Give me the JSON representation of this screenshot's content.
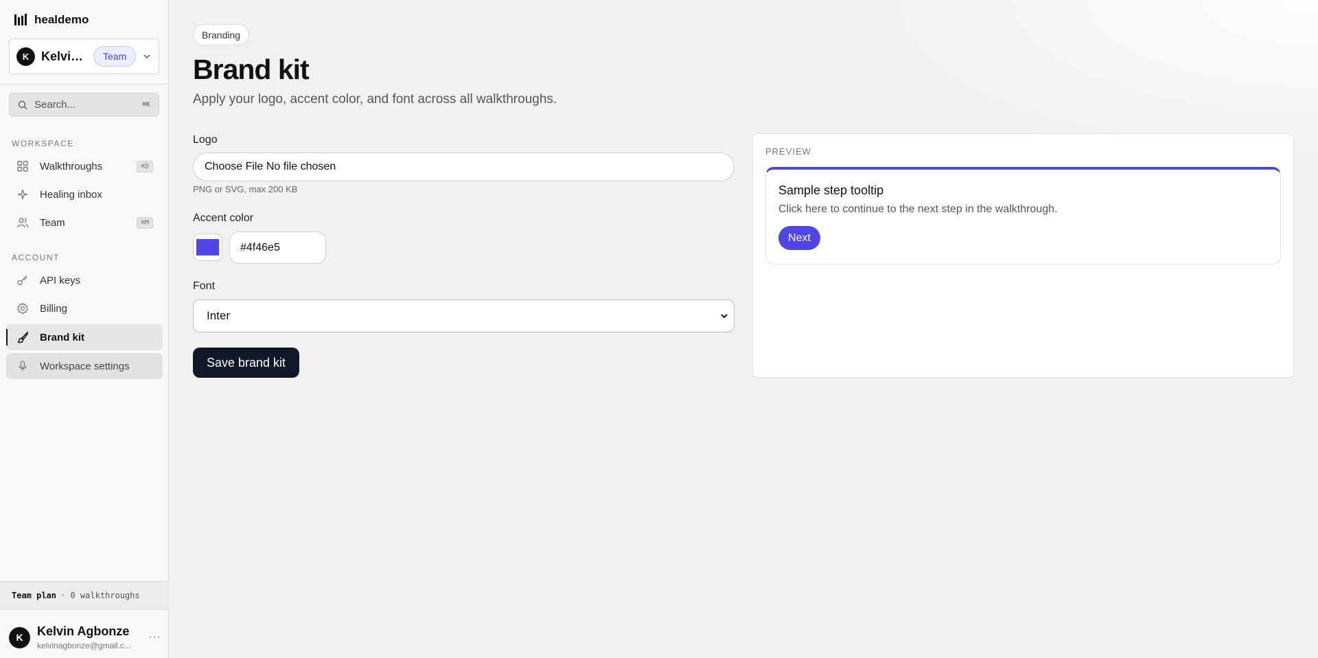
{
  "app": {
    "name": "healdemo"
  },
  "workspace_switcher": {
    "user_short": "Kelvin...",
    "badge": "Team"
  },
  "search": {
    "placeholder": "Search...",
    "shortcut": "⌘K"
  },
  "sidebar": {
    "workspace_label": "WORKSPACE",
    "account_label": "ACCOUNT",
    "workspace_items": [
      {
        "label": "Walkthroughs",
        "icon": "grid-icon",
        "shortcut": "⌘D"
      },
      {
        "label": "Healing inbox",
        "icon": "sparkle-icon",
        "shortcut": ""
      },
      {
        "label": "Team",
        "icon": "users-icon",
        "shortcut": "⌘M"
      }
    ],
    "account_items": [
      {
        "label": "API keys",
        "icon": "key-icon"
      },
      {
        "label": "Billing",
        "icon": "gear-icon"
      },
      {
        "label": "Brand kit",
        "icon": "paintbrush-icon",
        "active": true
      },
      {
        "label": "Workspace settings",
        "icon": "mic-icon"
      }
    ]
  },
  "plan": {
    "name": "Team plan",
    "detail": "· 0 walkthroughs"
  },
  "user": {
    "initial": "K",
    "name": "Kelvin Agbonze",
    "email": "kelvinagbonze@gmail.c...",
    "more": "···"
  },
  "page": {
    "breadcrumb": "Branding",
    "title": "Brand kit",
    "subtitle": "Apply your logo, accent color, and font across all walkthroughs."
  },
  "form": {
    "logo_label": "Logo",
    "logo_value": "Choose File No file chosen",
    "logo_hint": "PNG or SVG, max 200 KB",
    "accent_label": "Accent color",
    "accent_value": "#4f46e5",
    "font_label": "Font",
    "font_value": "Inter",
    "save_label": "Save brand kit"
  },
  "preview": {
    "label": "PREVIEW",
    "tooltip_title": "Sample step tooltip",
    "tooltip_body": "Click here to continue to the next step in the walkthrough.",
    "next_label": "Next"
  },
  "colors": {
    "accent": "#4f46e5",
    "button_dark": "#111827"
  }
}
